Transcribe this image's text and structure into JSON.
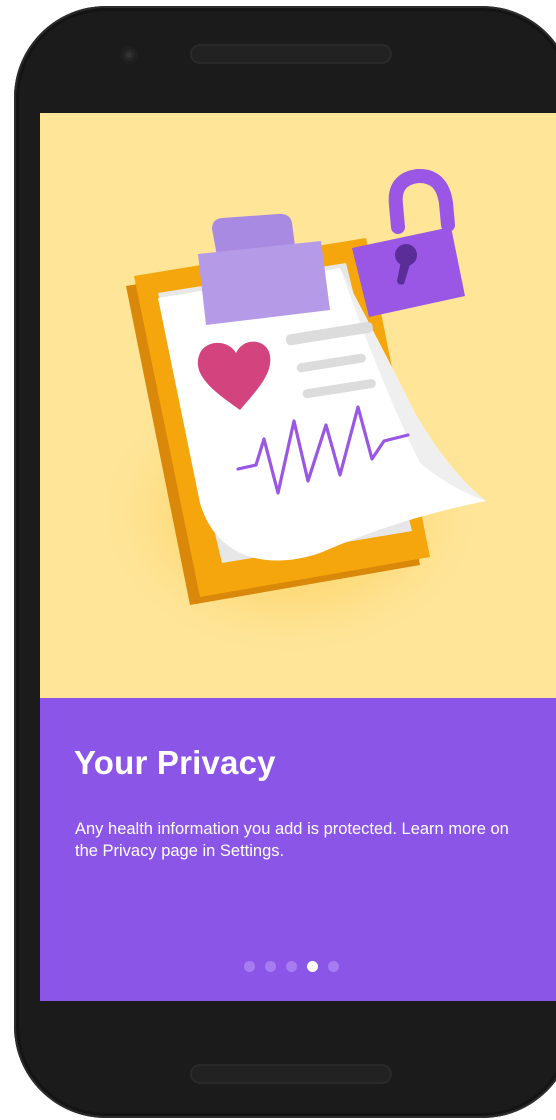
{
  "onboarding": {
    "title": "Your Privacy",
    "description": "Any health information you add is protected. Learn more on the Privacy page in Settings.",
    "page_count": 5,
    "current_page": 4
  },
  "colors": {
    "hero_background": "#fee598",
    "panel_background": "#8b55e7",
    "dot_inactive": "#a77cf0",
    "dot_active": "#ffffff",
    "clipboard": "#f5a60d",
    "lock": "#9a56e4",
    "heart": "#d3447f",
    "pulse": "#9a56e4"
  },
  "icons": {
    "illustration": "clipboard-health-lock-illustration"
  }
}
